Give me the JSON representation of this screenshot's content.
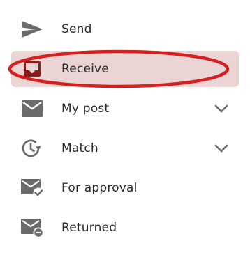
{
  "menu": {
    "items": [
      {
        "label": "Send",
        "icon": "send-icon",
        "active": false,
        "expandable": false
      },
      {
        "label": "Receive",
        "icon": "inbox-icon",
        "active": true,
        "expandable": false
      },
      {
        "label": "My post",
        "icon": "mail-icon",
        "active": false,
        "expandable": true
      },
      {
        "label": "Match",
        "icon": "history-icon",
        "active": false,
        "expandable": true
      },
      {
        "label": "For approval",
        "icon": "mail-check-icon",
        "active": false,
        "expandable": false
      },
      {
        "label": "Returned",
        "icon": "mail-minus-icon",
        "active": false,
        "expandable": false
      }
    ]
  },
  "colors": {
    "icon": "#6b6b6b",
    "active_icon": "#8a1c1c",
    "active_background": "#ebd4d4",
    "annotation_ring": "#d61f1f",
    "chevron": "#6b6b6b"
  }
}
